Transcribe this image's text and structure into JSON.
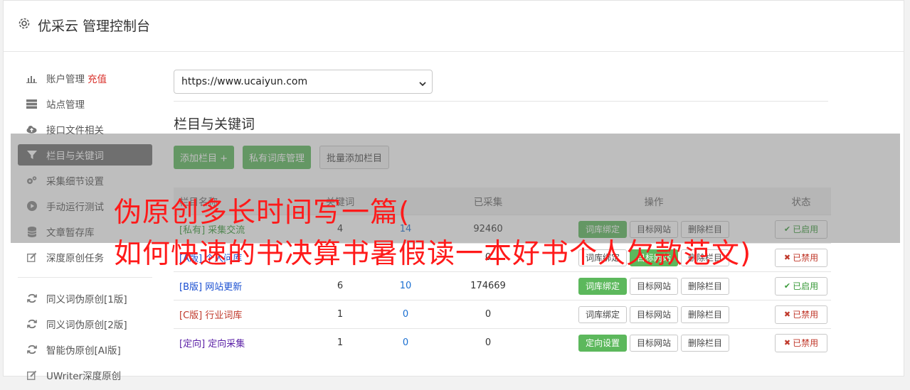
{
  "header": {
    "title": "优采云 管理控制台",
    "icon": "gear-icon"
  },
  "sidebar": {
    "items": [
      {
        "label": "账户管理",
        "extra": "充值",
        "icon": "bar-chart-icon"
      },
      {
        "label": "站点管理",
        "icon": "server-icon"
      },
      {
        "label": "接口文件相关",
        "icon": "cloud-upload-icon"
      },
      {
        "label": "栏目与关键词",
        "icon": "filter-icon",
        "active": true
      },
      {
        "label": "采集细节设置",
        "icon": "gears-icon"
      },
      {
        "label": "手动运行测试",
        "icon": "play-circle-icon"
      },
      {
        "label": "文章暂存库",
        "icon": "database-icon"
      },
      {
        "label": "深度原创任务",
        "icon": "edit-icon"
      }
    ],
    "items2": [
      {
        "label": "同义词伪原创[1版]",
        "icon": "refresh-icon"
      },
      {
        "label": "同义词伪原创[2版]",
        "icon": "refresh-icon"
      },
      {
        "label": "智能伪原创[AI版]",
        "icon": "refresh-icon"
      },
      {
        "label": "UWriter深度原创",
        "icon": "edit-icon"
      }
    ]
  },
  "site_select": {
    "value": "https://www.ucaiyun.com"
  },
  "section_title": "栏目与关键词",
  "toolbar": {
    "add_column": "添加栏目 +",
    "private_lib": "私有词库管理",
    "batch_add": "批量添加栏目"
  },
  "table": {
    "headers": [
      "栏目名称",
      "关键词",
      "已采集",
      "操作",
      "状态"
    ],
    "rows": [
      {
        "tag": "[私有]",
        "name": "采集交流",
        "kw": "4",
        "n": "14",
        "collected": "92460",
        "op1": "词库绑定",
        "op2": "目标网站",
        "op3": "删除栏目",
        "status": "已启用",
        "on": true
      },
      {
        "tag": "[A版]",
        "name": "个人问库",
        "kw": "",
        "n": "",
        "collected": "0",
        "op1": "词库绑定",
        "op2": "目标网站",
        "op3": "删除栏目",
        "status": "已禁用",
        "on": false
      },
      {
        "tag": "[B版]",
        "name": "网站更新",
        "kw": "6",
        "n": "10",
        "collected": "174669",
        "op1": "词库绑定",
        "op2": "目标网站",
        "op3": "删除栏目",
        "status": "已启用",
        "on": true
      },
      {
        "tag": "[C版]",
        "name": "行业词库",
        "kw": "1",
        "n": "0",
        "collected": "0",
        "op1": "词库绑定",
        "op2": "目标网站",
        "op3": "删除栏目",
        "status": "已禁用",
        "on": false
      },
      {
        "tag": "[定向]",
        "name": "定向采集",
        "kw": "1",
        "n": "0",
        "collected": "0",
        "op1": "定向设置",
        "op2": "目标网站",
        "op3": "删除栏目",
        "status": "已禁用",
        "on": false
      }
    ]
  },
  "watermark": {
    "line1": "伪原创多长时间写一篇(",
    "line2": "如何快速的书决算书暑假读一本好书个人欠款范文)"
  }
}
